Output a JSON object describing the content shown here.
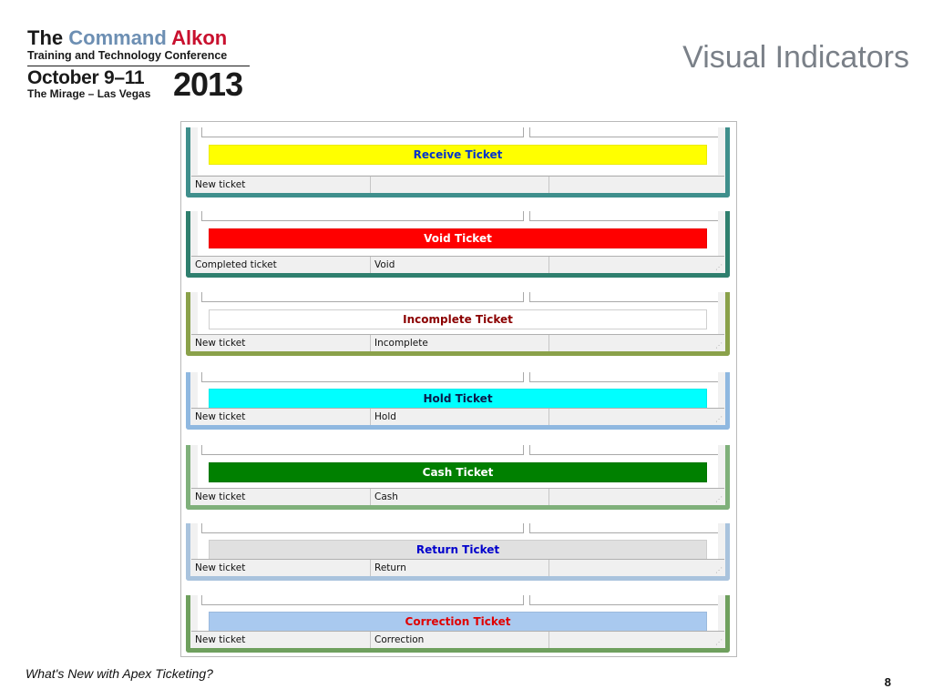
{
  "logo": {
    "the": "The",
    "command": "Command",
    "alkon": "Alkon",
    "subtitle": "Training and Technology Conference",
    "date": "October 9–11",
    "venue": "The Mirage – Las Vegas",
    "year": "2013"
  },
  "slide_title": "Visual Indicators",
  "colors": {
    "receive": "#ffff00",
    "void": "#ff0000",
    "incomplete": "#ffffff",
    "hold": "#00ffff",
    "cash": "#008000",
    "return": "#e0e0e0",
    "correction": "#a9c9ef"
  },
  "panels": [
    {
      "label": "Receive Ticket",
      "status": "New ticket",
      "type": ""
    },
    {
      "label": "Void Ticket",
      "status": "Completed ticket",
      "type": "Void"
    },
    {
      "label": "Incomplete Ticket",
      "status": "New ticket",
      "type": "Incomplete"
    },
    {
      "label": "Hold Ticket",
      "status": "New ticket",
      "type": "Hold"
    },
    {
      "label": "Cash Ticket",
      "status": "New ticket",
      "type": "Cash"
    },
    {
      "label": "Return Ticket",
      "status": "New ticket",
      "type": "Return"
    },
    {
      "label": "Correction Ticket",
      "status": "New ticket",
      "type": "Correction"
    }
  ],
  "footer": {
    "text": "What's New with Apex Ticketing?",
    "page": "8"
  }
}
